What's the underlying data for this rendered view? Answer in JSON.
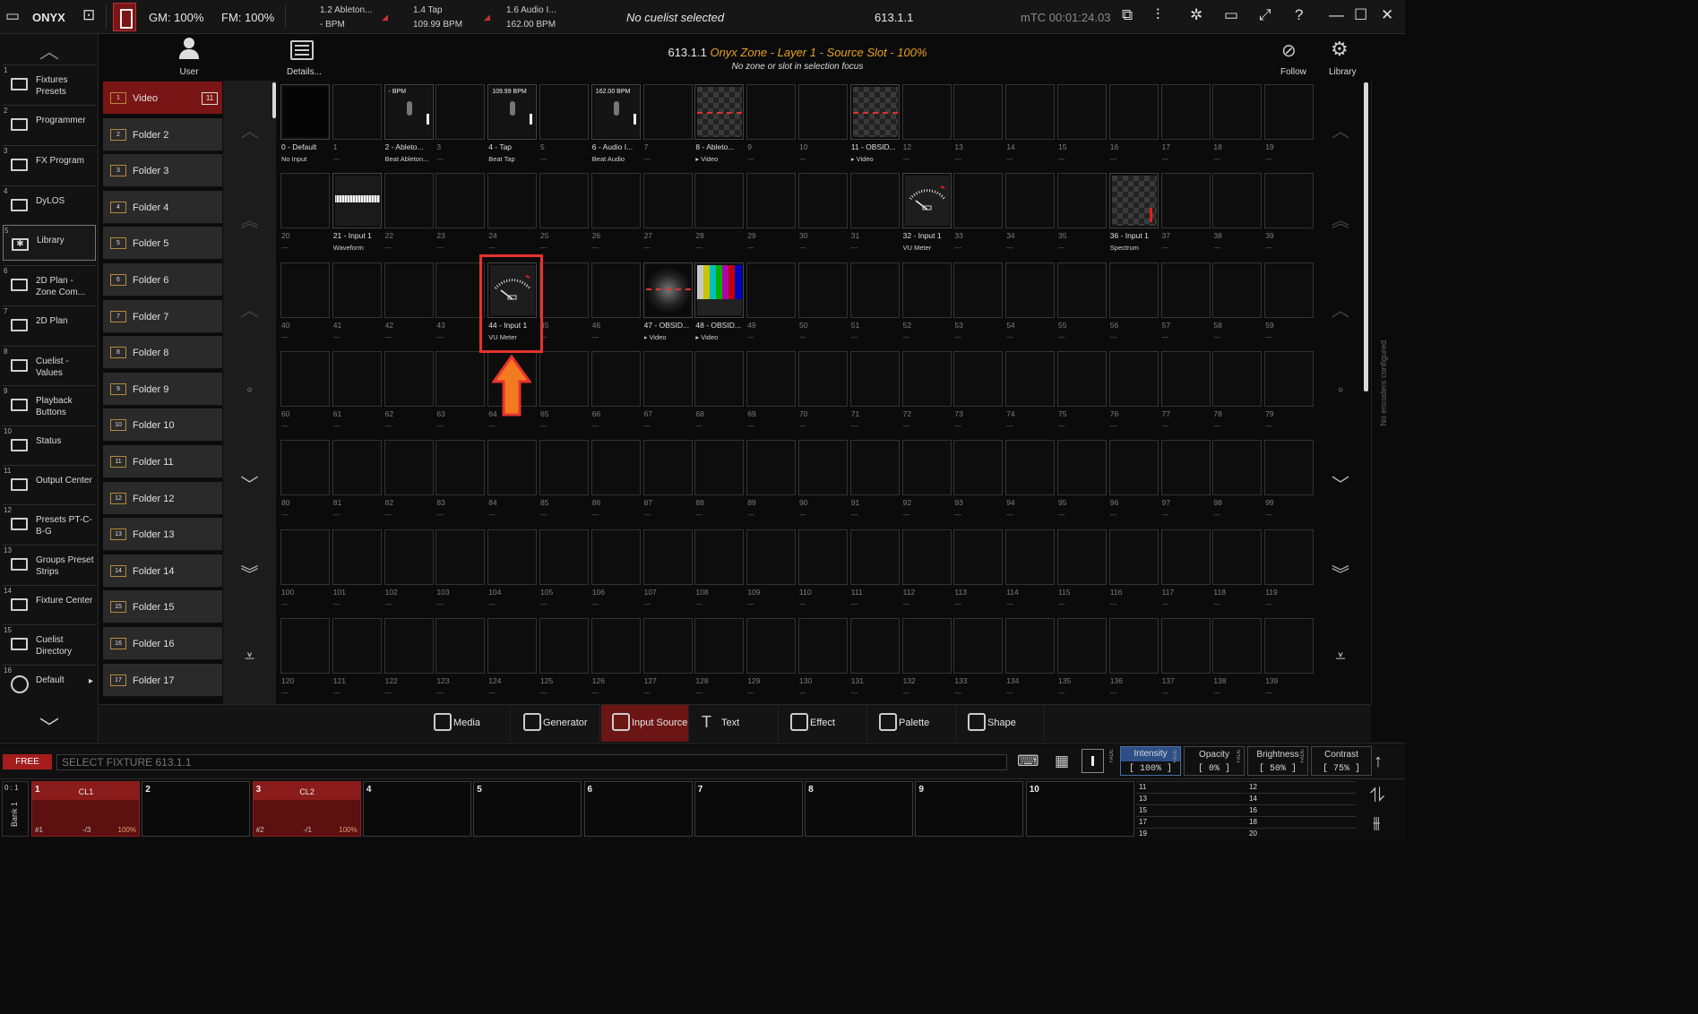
{
  "topbar": {
    "brand": "ONYX",
    "gm": "GM: 100%",
    "fm": "FM: 100%",
    "beat_sources": [
      {
        "name": "1.2 Ableton...",
        "value": "- BPM"
      },
      {
        "name": "1.4 Tap",
        "value": "109.99 BPM"
      },
      {
        "name": "1.6 Audio I...",
        "value": "162.00 BPM"
      }
    ],
    "cuelist_status": "No cuelist selected",
    "selection": "613.1.1",
    "timecode": "mTC 00:01:24.03"
  },
  "sidebar": {
    "items": [
      {
        "num": "1",
        "label": "Fixtures Presets"
      },
      {
        "num": "2",
        "label": "Programmer"
      },
      {
        "num": "3",
        "label": "FX Program"
      },
      {
        "num": "4",
        "label": "DyLOS"
      },
      {
        "num": "5",
        "label": "Library"
      },
      {
        "num": "6",
        "label": "2D Plan - Zone Com..."
      },
      {
        "num": "7",
        "label": "2D Plan"
      },
      {
        "num": "8",
        "label": "Cuelist - Values"
      },
      {
        "num": "9",
        "label": "Playback Buttons"
      },
      {
        "num": "10",
        "label": "Status"
      },
      {
        "num": "11",
        "label": "Output Center"
      },
      {
        "num": "12",
        "label": "Presets PT-C-B-G"
      },
      {
        "num": "13",
        "label": "Groups Preset Strips"
      },
      {
        "num": "14",
        "label": "Fixture Center"
      },
      {
        "num": "15",
        "label": "Cuelist Directory"
      },
      {
        "num": "16",
        "label": "Default"
      }
    ]
  },
  "user_label": "User",
  "details_label": "Details...",
  "folders": [
    {
      "num": "1",
      "label": "Video",
      "count": "11"
    },
    {
      "num": "2",
      "label": "Folder 2"
    },
    {
      "num": "3",
      "label": "Folder 3"
    },
    {
      "num": "4",
      "label": "Folder 4"
    },
    {
      "num": "5",
      "label": "Folder 5"
    },
    {
      "num": "6",
      "label": "Folder 6"
    },
    {
      "num": "7",
      "label": "Folder 7"
    },
    {
      "num": "8",
      "label": "Folder 8"
    },
    {
      "num": "9",
      "label": "Folder 9"
    },
    {
      "num": "10",
      "label": "Folder 10"
    },
    {
      "num": "11",
      "label": "Folder 11"
    },
    {
      "num": "12",
      "label": "Folder 12"
    },
    {
      "num": "13",
      "label": "Folder 13"
    },
    {
      "num": "14",
      "label": "Folder 14"
    },
    {
      "num": "15",
      "label": "Folder 15"
    },
    {
      "num": "16",
      "label": "Folder 16"
    },
    {
      "num": "17",
      "label": "Folder 17"
    }
  ],
  "header": {
    "title_prefix": "613.1.1",
    "title_main": "Onyx Zone - Layer 1 - Source Slot - 100%",
    "subtitle": "No zone or slot in selection focus",
    "follow_label": "Follow",
    "library_label": "Library"
  },
  "named_slots": {
    "0": {
      "name": "0 - Default",
      "sub": "No Input",
      "thumb": "black"
    },
    "2": {
      "name": "2 - Ableto...",
      "sub": "Beat  Ableton...",
      "thumb": "beat",
      "label": "- BPM"
    },
    "4": {
      "name": "4 - Tap",
      "sub": "Beat Tap",
      "thumb": "beat",
      "label": "109.99 BPM"
    },
    "6": {
      "name": "6 - Audio I...",
      "sub": "Beat Audio",
      "thumb": "beat",
      "label": "162.00 BPM"
    },
    "8": {
      "name": "8 - Ableto...",
      "sub": "▸ Video",
      "thumb": "checker"
    },
    "11": {
      "name": "11 - OBSID...",
      "sub": "▸ Video",
      "thumb": "checker"
    },
    "21": {
      "name": "21 - Input 1",
      "sub": "Waveform",
      "thumb": "wave"
    },
    "32": {
      "name": "32 - Input 1",
      "sub": "VU Meter",
      "thumb": "vu"
    },
    "36": {
      "name": "36 - Input 1",
      "sub": "Spectrum",
      "thumb": "spectrum"
    },
    "44": {
      "name": "44 - Input 1",
      "sub": "VU Meter",
      "thumb": "vu"
    },
    "47": {
      "name": "47 - OBSID...",
      "sub": "▸ Video",
      "thumb": "dark"
    },
    "48": {
      "name": "48 - OBSID...",
      "sub": "▸ Video",
      "thumb": "bars"
    }
  },
  "selected_slot": "44",
  "empty_sub": "---",
  "encoder_note": "No encoders configured",
  "tabs": [
    {
      "label": "Media",
      "icon": "media-icon"
    },
    {
      "label": "Generator",
      "icon": "atom-icon"
    },
    {
      "label": "Input Source",
      "icon": "input-icon"
    },
    {
      "label": "Text",
      "icon": "text-icon"
    },
    {
      "label": "Effect",
      "icon": "wand-icon"
    },
    {
      "label": "Palette",
      "icon": "palette-icon"
    },
    {
      "label": "Shape",
      "icon": "shape-icon"
    }
  ],
  "command": {
    "mode": "FREE",
    "placeholder": "SELECT FIXTURE 613.1.1"
  },
  "params": [
    {
      "name": "Intensity",
      "value": "[ 100% ]",
      "fade": "FADE"
    },
    {
      "name": "Opacity",
      "value": "[ 0% ]",
      "fade": "FADE"
    },
    {
      "name": "Brightness",
      "value": "[ 50% ]",
      "fade": "FADE"
    },
    {
      "name": "Contrast",
      "value": "[ 75% ]",
      "fade": "FADE"
    }
  ],
  "bank": {
    "label": "Bank 1",
    "range": "0 : 1"
  },
  "playbacks": [
    {
      "num": "1",
      "name": "CL1",
      "id": "#1",
      "cue": "-/3",
      "level": "100%"
    },
    {
      "num": "2"
    },
    {
      "num": "3",
      "name": "CL2",
      "id": "#2",
      "cue": "-/1",
      "level": "100%"
    },
    {
      "num": "4"
    },
    {
      "num": "5"
    },
    {
      "num": "6"
    },
    {
      "num": "7"
    },
    {
      "num": "8"
    },
    {
      "num": "9"
    },
    {
      "num": "10"
    }
  ],
  "mini_playbacks": [
    "11",
    "12",
    "13",
    "14",
    "15",
    "16",
    "17",
    "18",
    "19",
    "20"
  ],
  "colors": {
    "accent_red": "#7a1515",
    "highlight_orange": "#e8a020",
    "annotation_red": "#e5322d",
    "arrow_orange": "#f47a20"
  }
}
